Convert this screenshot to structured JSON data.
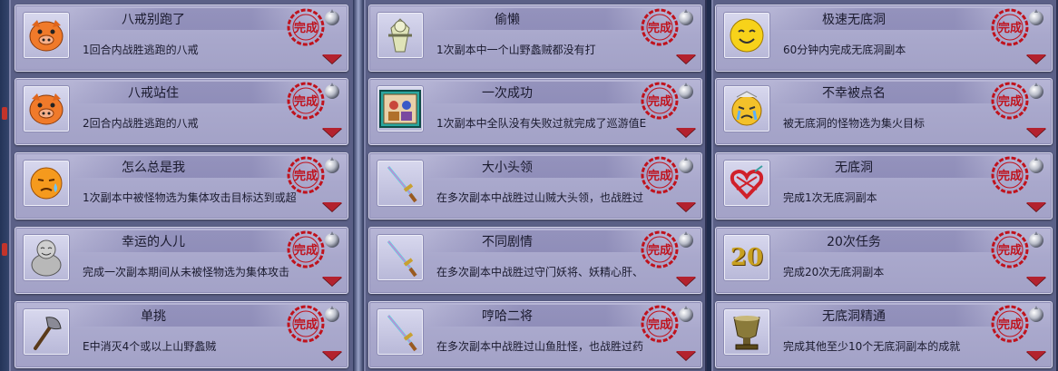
{
  "columns": [
    {
      "cards": [
        {
          "title": "八戒别跑了",
          "desc": "1回合内战胜逃跑的八戒",
          "icon": "pig-face-icon"
        },
        {
          "title": "八戒站住",
          "desc": "2回合内战胜逃跑的八戒",
          "icon": "pig-face-icon"
        },
        {
          "title": "怎么总是我",
          "desc": "1次副本中被怪物选为集体攻击目标达到或超",
          "icon": "sweat-face-icon"
        },
        {
          "title": "幸运的人儿",
          "desc": "完成一次副本期间从未被怪物选为集体攻击",
          "icon": "laughing-buddha-icon"
        },
        {
          "title": "单挑",
          "desc": "E中消灭4个或以上山野蠡贼",
          "icon": "axe-icon"
        }
      ]
    },
    {
      "cards": [
        {
          "title": "偷懒",
          "desc": "1次副本中一个山野蠡贼都没有打",
          "icon": "scarecrow-icon"
        },
        {
          "title": "一次成功",
          "desc": "1次副本中全队没有失败过就完成了巡游值E",
          "icon": "team-portrait-icon"
        },
        {
          "title": "大小头领",
          "desc": "在多次副本中战胜过山贼大头领，也战胜过",
          "icon": "sword-icon"
        },
        {
          "title": "不同剧情",
          "desc": "在多次副本中战胜过守门妖将、妖精心肝、",
          "icon": "sword-icon"
        },
        {
          "title": "哼哈二将",
          "desc": "在多次副本中战胜过山鱼肚怪，也战胜过药",
          "icon": "sword-icon"
        }
      ]
    },
    {
      "cards": [
        {
          "title": "极速无底洞",
          "desc": "60分钟内完成无底洞副本",
          "icon": "smiley-face-icon"
        },
        {
          "title": "不幸被点名",
          "desc": "被无底洞的怪物选为集火目标",
          "icon": "crying-face-icon"
        },
        {
          "title": "无底洞",
          "desc": "完成1次无底洞副本",
          "icon": "heart-knot-icon"
        },
        {
          "title": "20次任务",
          "desc": "完成20次无底洞副本",
          "icon": "number-20-icon",
          "icon_text": "20"
        },
        {
          "title": "无底洞精通",
          "desc": "完成其他至少10个无底洞副本的成就",
          "icon": "chalice-icon"
        }
      ]
    }
  ],
  "stamp": {
    "text": "完成",
    "color": "#c0121c"
  },
  "colors": {
    "card": "#a9a8cc",
    "arrow": "#b3222e",
    "panel": "#5b6087"
  }
}
